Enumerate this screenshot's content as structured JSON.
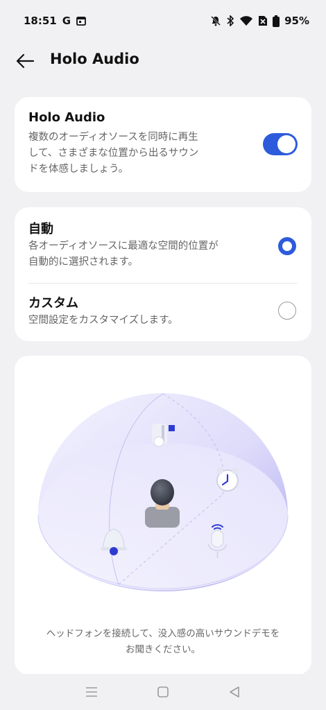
{
  "status_bar": {
    "time": "18:51",
    "carrier_icon": "G",
    "battery_percent": "95%",
    "icons": [
      "google-icon",
      "calendar-icon",
      "mute-icon",
      "bluetooth-icon",
      "wifi-icon",
      "sim-off-icon",
      "battery-icon"
    ]
  },
  "header": {
    "title": "Holo Audio",
    "back_icon": "arrow-left-icon"
  },
  "holo_card": {
    "title": "Holo Audio",
    "description_lines": [
      "複数のオーディオソースを同時に再生",
      "して、さまざまな位置から出るサウン",
      "ドを体感しましょう。"
    ],
    "toggle_on": true
  },
  "mode_card": {
    "auto": {
      "title": "自動",
      "description_lines": [
        "各オーディオソースに最適な空間的位置が",
        "自動的に選択されます。"
      ],
      "selected": true
    },
    "custom": {
      "title": "カスタム",
      "description": "空間設定をカスタマイズします。",
      "selected": false
    }
  },
  "illustration": {
    "caption_lines": [
      "ヘッドフォンを接続して、没入感の高いサウンドデモを",
      "お聞きください。"
    ],
    "icons": [
      "music-note-icon",
      "alarm-clock-icon",
      "bell-icon",
      "microphone-icon",
      "listener-avatar-icon"
    ]
  },
  "nav_bar": {
    "icons": [
      "menu-icon",
      "home-icon",
      "back-triangle-icon"
    ]
  },
  "colors": {
    "accent": "#2e5bdc",
    "background": "#f1f1f3",
    "card": "#ffffff",
    "dome": "#b9b4f2"
  }
}
